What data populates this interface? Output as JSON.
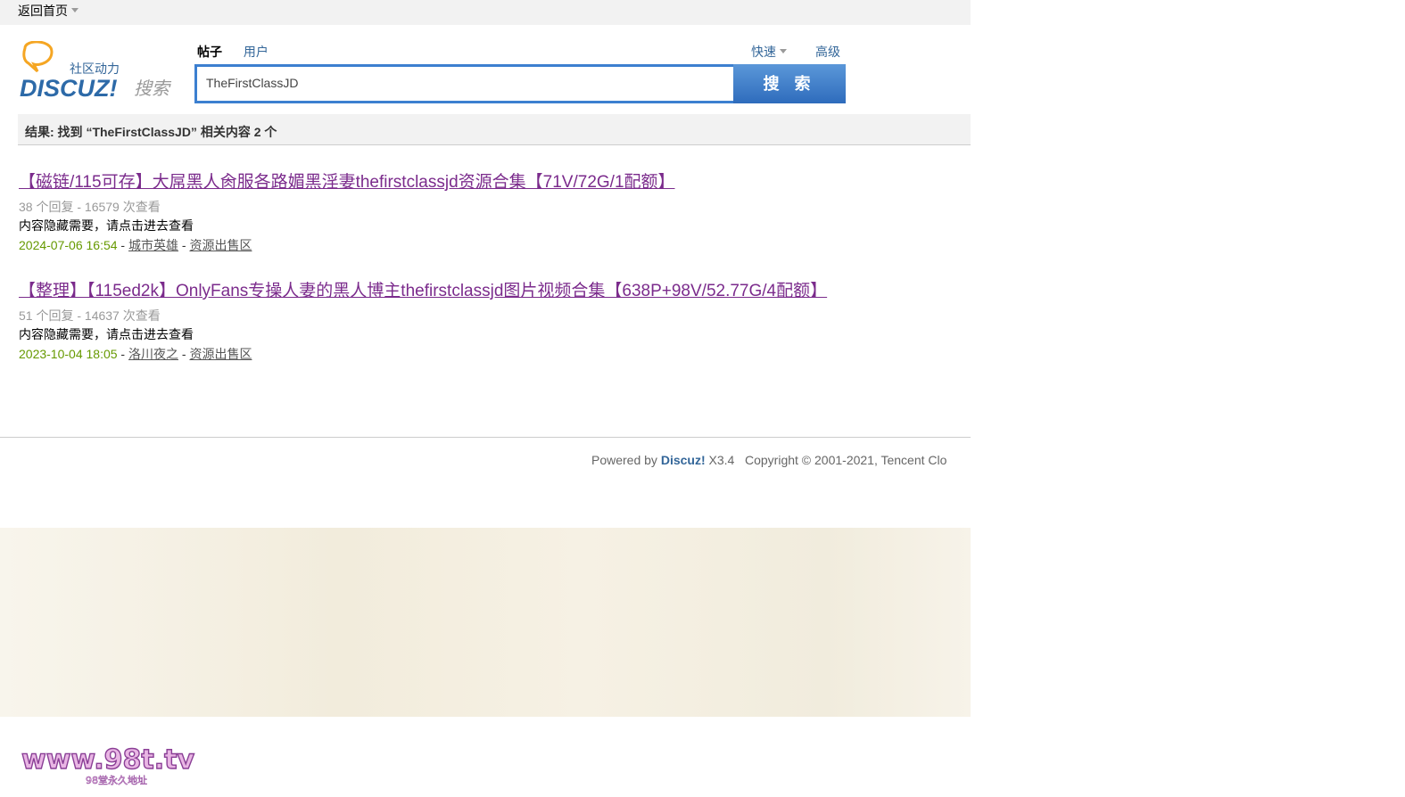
{
  "topbar": {
    "home_label": "返回首页"
  },
  "logo": {
    "line1": "社区动力",
    "brand": "DISCUZ!",
    "suffix": "搜索"
  },
  "search": {
    "tabs": [
      {
        "label": "帖子"
      },
      {
        "label": "用户"
      }
    ],
    "quick_label": "快速",
    "advanced_label": "高级",
    "query": "TheFirstClassJD",
    "button_label": "搜 索"
  },
  "results_header": "结果: 找到 “TheFirstClassJD” 相关内容 2 个",
  "results": [
    {
      "title": "【磁链/115可存】大屌黑人肏服各路媚黑淫妻thefirstclassjd资源合集【71V/72G/1配额】",
      "meta": "38 个回复 - 16579 次查看",
      "desc": "内容隐藏需要，请点击进去查看",
      "date": "2024-07-06 16:54",
      "author": "城市英雄",
      "forum": "资源出售区"
    },
    {
      "title": "【整理】【115ed2k】OnlyFans专操人妻的黑人博主thefirstclassjd图片视频合集【638P+98V/52.77G/4配额】",
      "meta": "51 个回复 - 14637 次查看",
      "desc": "内容隐藏需要，请点击进去查看",
      "date": "2023-10-04 18:05",
      "author": "洛川夜之",
      "forum": "资源出售区"
    }
  ],
  "footer": {
    "powered": "Powered by",
    "brand": "Discuz!",
    "version": "X3.4",
    "copyright": "Copyright © 2001-2021, Tencent Clo"
  },
  "watermark": {
    "text": "www.98t.tv",
    "sub": "98堂永久地址"
  },
  "colors": {
    "accent": "#336699",
    "link_visited": "#7b2b8c",
    "date": "#669900",
    "button": "#3c7fd0"
  }
}
